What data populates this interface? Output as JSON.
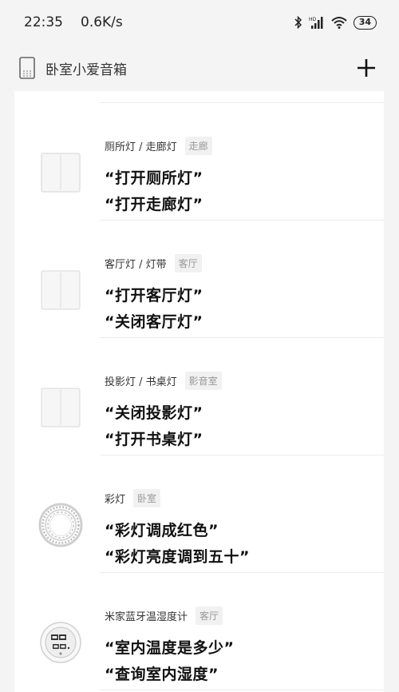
{
  "status": {
    "time": "22:35",
    "speed": "0.6K/s",
    "battery": "34"
  },
  "header": {
    "title": "卧室小爱音箱"
  },
  "items": [
    {
      "name": "厕所灯 / 走廊灯",
      "room": "走廊",
      "icon": "switch-icon",
      "commands": [
        "“打开厕所灯”",
        "“打开走廊灯”"
      ]
    },
    {
      "name": "客厅灯 / 灯带",
      "room": "客厅",
      "icon": "switch-icon",
      "commands": [
        "“打开客厅灯”",
        "“关闭客厅灯”"
      ]
    },
    {
      "name": "投影灯 / 书桌灯",
      "room": "影音室",
      "icon": "switch-icon",
      "commands": [
        "“关闭投影灯”",
        "“打开书桌灯”"
      ]
    },
    {
      "name": "彩灯",
      "room": "卧室",
      "icon": "light-strip-icon",
      "commands": [
        "“彩灯调成红色”",
        "“彩灯亮度调到五十”"
      ]
    },
    {
      "name": "米家蓝牙温湿度计",
      "room": "客厅",
      "icon": "thermometer-icon",
      "commands": [
        "“室内温度是多少”",
        "“查询室内湿度”"
      ]
    }
  ]
}
